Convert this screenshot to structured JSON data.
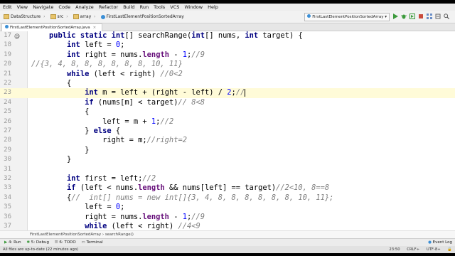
{
  "menu": [
    "Edit",
    "View",
    "Navigate",
    "Code",
    "Analyze",
    "Refactor",
    "Build",
    "Run",
    "Tools",
    "VCS",
    "Window",
    "Help"
  ],
  "nav": {
    "project": "DataStructure",
    "folder1": "src",
    "folder2": "array",
    "file": "FirstLastElementPositionSortedArray",
    "run_config": "FirstLastElementPositionSortedArray"
  },
  "tab": {
    "label": "FirstLastElementPositionSortedArray.java"
  },
  "editor": {
    "line_numbers": [
      "17",
      "18",
      "19",
      "20",
      "21",
      "22",
      "23",
      "24",
      "25",
      "26",
      "27",
      "28",
      "29",
      "30",
      "31",
      "32",
      "33",
      "34",
      "35",
      "36",
      "37"
    ],
    "lines": [
      "    public static int[] searchRange(int[] nums, int target) {",
      "        int left = 0;",
      "        int right = nums.length - 1;//9",
      "//{3, 4, 8, 8, 8, 8, 8, 8, 10, 11}",
      "        while (left < right) //0<2",
      "        {",
      "            int m = left + (right - left) / 2;//",
      "            if (nums[m] < target)// 8<8",
      "            {",
      "                left = m + 1;//2",
      "            } else {",
      "                right = m;//right=2",
      "            }",
      "        }",
      "",
      "        int first = left;//2",
      "        if (left < nums.length && nums[left] == target)//2<10, 8==8",
      "        {//  int[] nums = new int[]{3, 4, 8, 8, 8, 8, 8, 8, 10, 11};",
      "            left = 0;",
      "            right = nums.length - 1;//9",
      "            while (left < right) //4<9"
    ]
  },
  "code_breadcrumb": "FirstLastElementPositionSortedArray › searchRange()",
  "toolwindows": {
    "run": "4: Run",
    "debug": "5: Debug",
    "todo": "6: TODO",
    "terminal": "Terminal",
    "event_log": "Event Log"
  },
  "status": {
    "message": "All files are up-to-date (22 minutes ago)",
    "position": "23:50",
    "line_sep": "CRLF÷",
    "encoding": "UTF-8÷"
  },
  "colors": {
    "keyword": "#000080",
    "number": "#0000ff",
    "comment": "#808080",
    "field": "#660e7a",
    "current_line": "#fffbd8"
  }
}
